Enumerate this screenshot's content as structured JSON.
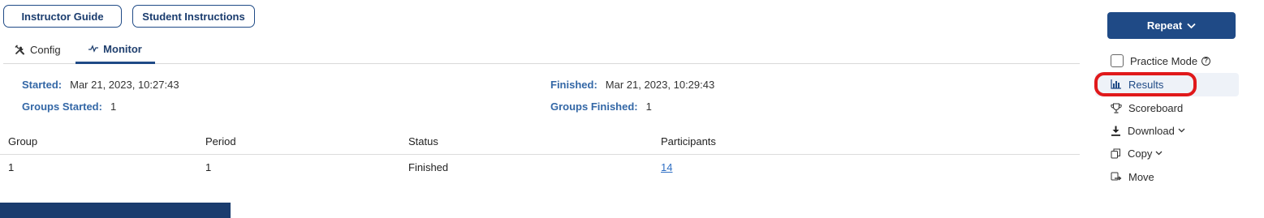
{
  "top_buttons": {
    "instructor_guide": "Instructor Guide",
    "student_instructions": "Student Instructions"
  },
  "tabs": [
    {
      "label": "Config",
      "icon": "tools-icon",
      "active": false
    },
    {
      "label": "Monitor",
      "icon": "activity-icon",
      "active": true
    }
  ],
  "info": {
    "started_label": "Started:",
    "started_value": "Mar 21, 2023, 10:27:43",
    "groups_started_label": "Groups Started:",
    "groups_started_value": "1",
    "finished_label": "Finished:",
    "finished_value": "Mar 21, 2023, 10:29:43",
    "groups_finished_label": "Groups Finished:",
    "groups_finished_value": "1"
  },
  "table": {
    "columns": [
      "Group",
      "Period",
      "Status",
      "Participants"
    ],
    "rows": [
      {
        "group": "1",
        "period": "1",
        "status": "Finished",
        "participants": "14"
      }
    ]
  },
  "sidebar": {
    "repeat_label": "Repeat",
    "practice_mode_label": "Practice Mode",
    "practice_mode_checked": false,
    "items": [
      {
        "label": "Results",
        "icon": "bar-chart-icon",
        "highlighted": true
      },
      {
        "label": "Scoreboard",
        "icon": "trophy-icon"
      },
      {
        "label": "Download",
        "icon": "download-icon",
        "dropdown": true
      },
      {
        "label": "Copy",
        "icon": "copy-icon",
        "dropdown": true
      },
      {
        "label": "Move",
        "icon": "move-icon"
      }
    ]
  },
  "colors": {
    "primary": "#1f4a86",
    "label_blue": "#3367a6",
    "highlight_ring": "#e0191b",
    "link": "#2f6fc4"
  }
}
